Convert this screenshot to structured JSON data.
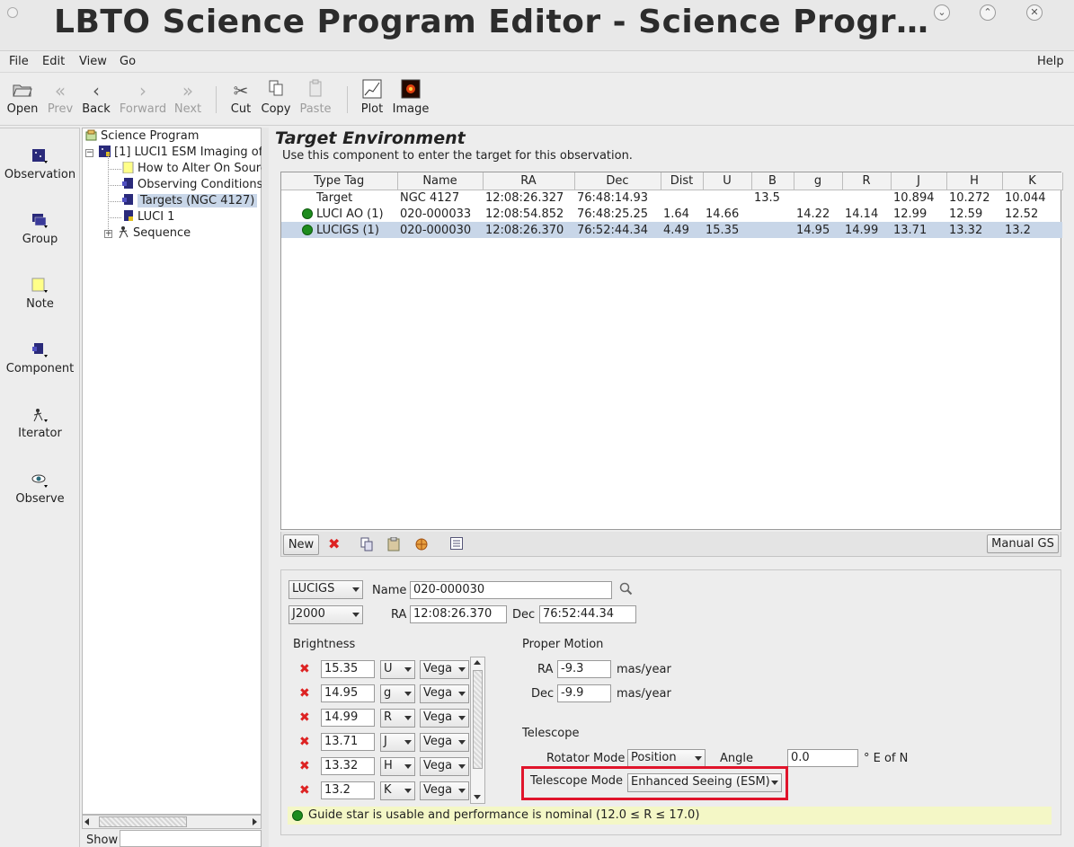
{
  "window": {
    "title": "LBTO Science Program Editor - Science Progr…",
    "btn_min": "⌄",
    "btn_max": "⌃",
    "btn_close": "✕"
  },
  "menu": {
    "file": "File",
    "edit": "Edit",
    "view": "View",
    "go": "Go",
    "help": "Help"
  },
  "toolbar": {
    "open": "Open",
    "prev": "Prev",
    "back": "Back",
    "forward": "Forward",
    "next": "Next",
    "cut": "Cut",
    "copy": "Copy",
    "paste": "Paste",
    "plot": "Plot",
    "image": "Image"
  },
  "palette": {
    "observation": "Observation",
    "group": "Group",
    "note": "Note",
    "component": "Component",
    "iterator": "Iterator",
    "observe": "Observe"
  },
  "tree": {
    "root": "Science Program",
    "obs": "[1] LUCI1 ESM Imaging of",
    "note": "How to Alter On Sourc",
    "conditions": "Observing Conditions",
    "targets": "Targets (NGC 4127)",
    "luci": "LUCI 1",
    "sequence": "Sequence",
    "show_label": "Show"
  },
  "main": {
    "title": "Target Environment",
    "subtitle": "Use this component to enter the target for this observation."
  },
  "table": {
    "headers": [
      "Type Tag",
      "Name",
      "RA",
      "Dec",
      "Dist",
      "U",
      "B",
      "g",
      "R",
      "J",
      "H",
      "K"
    ],
    "rows": [
      {
        "tag": "Target",
        "name": "NGC 4127",
        "ra": "12:08:26.327",
        "dec": "76:48:14.93",
        "dist": "",
        "u": "",
        "b": "13.5",
        "g": "",
        "r": "",
        "j": "10.894",
        "h": "10.272",
        "k": "10.044"
      },
      {
        "tag": "LUCI AO (1)",
        "name": "020-000033",
        "ra": "12:08:54.852",
        "dec": "76:48:25.25",
        "dist": "1.64",
        "u": "14.66",
        "b": "",
        "g": "14.22",
        "r": "14.14",
        "j": "12.99",
        "h": "12.59",
        "k": "12.52"
      },
      {
        "tag": "LUCIGS (1)",
        "name": "020-000030",
        "ra": "12:08:26.370",
        "dec": "76:52:44.34",
        "dist": "4.49",
        "u": "15.35",
        "b": "",
        "g": "14.95",
        "r": "14.99",
        "j": "13.71",
        "h": "13.32",
        "k": "13.2"
      }
    ],
    "new_button": "New",
    "manual_gs_button": "Manual GS"
  },
  "detail": {
    "type_select": "LUCIGS",
    "name_label": "Name",
    "name_value": "020-000030",
    "coord_system": "J2000",
    "ra_label": "RA",
    "ra_value": "12:08:26.370",
    "dec_label": "Dec",
    "dec_value": "76:52:44.34",
    "brightness_label": "Brightness",
    "brightness": [
      {
        "value": "15.35",
        "band": "U",
        "system": "Vega"
      },
      {
        "value": "14.95",
        "band": "g",
        "system": "Vega"
      },
      {
        "value": "14.99",
        "band": "R",
        "system": "Vega"
      },
      {
        "value": "13.71",
        "band": "J",
        "system": "Vega"
      },
      {
        "value": "13.32",
        "band": "H",
        "system": "Vega"
      },
      {
        "value": "13.2",
        "band": "K",
        "system": "Vega"
      }
    ],
    "proper_motion_label": "Proper Motion",
    "pm_ra_label": "RA",
    "pm_ra_value": "-9.3",
    "pm_dec_label": "Dec",
    "pm_dec_value": "-9.9",
    "pm_unit": "mas/year",
    "telescope_label": "Telescope",
    "rotator_mode_label": "Rotator Mode",
    "rotator_mode_value": "Position",
    "angle_label": "Angle",
    "angle_value": "0.0",
    "angle_unit": "° E of N",
    "telescope_mode_label": "Telescope Mode",
    "telescope_mode_value": "Enhanced Seeing (ESM)",
    "status": "Guide star is usable and performance is nominal (12.0 ≤ R ≤ 17.0)"
  },
  "colors": {
    "highlight_box": "#e0142b",
    "selection": "#c8d6e8",
    "status_bg": "#f4f7c6",
    "ok_dot": "#1e8c1e"
  }
}
